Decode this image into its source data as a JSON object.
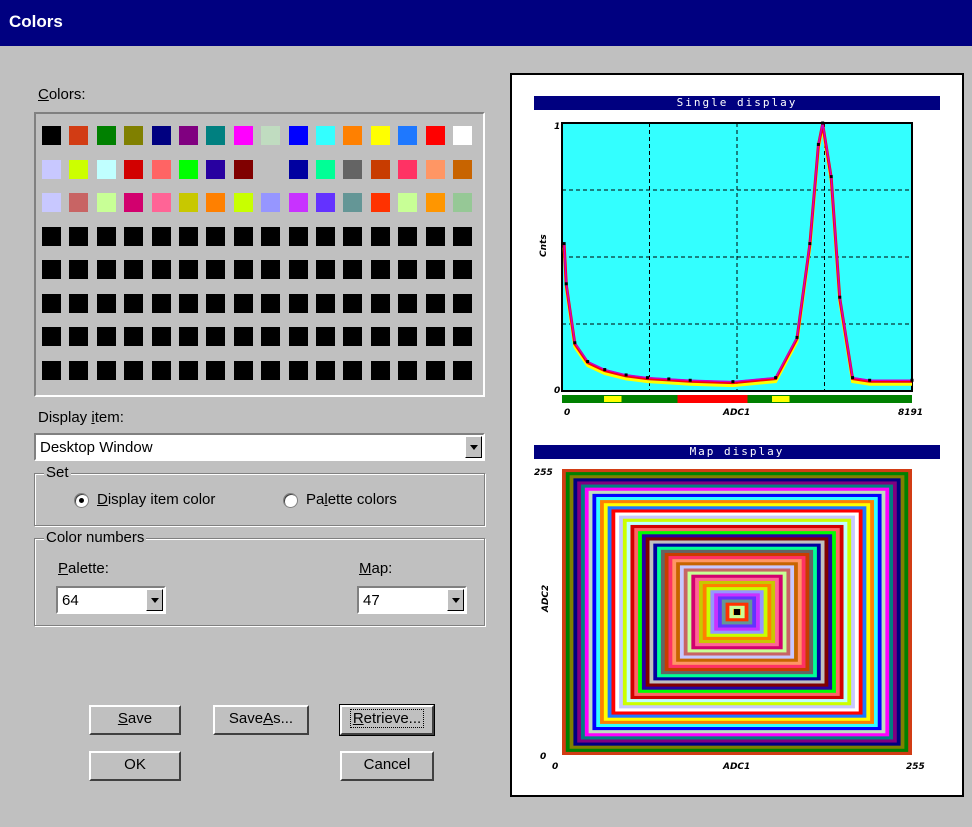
{
  "window": {
    "title": "Colors"
  },
  "colors_label": "Colors:",
  "palette": [
    [
      "#000000",
      "#d23c14",
      "#008000",
      "#808000",
      "#000080",
      "#800080",
      "#008080",
      "#ff00ff",
      "#c0dcc0",
      "#0000ff",
      "#33ffff",
      "#ff8000",
      "#ffff00",
      "#1e78ff",
      "#ff0000",
      "#ffffff"
    ],
    [
      "#c8c8ff",
      "#ccff00",
      "#c0ffff",
      "#d20000",
      "#ff6464",
      "#00ff00",
      "#2800a0",
      "#800000",
      "#c0c0c0",
      "#0000a0",
      "#00ff96",
      "#646464",
      "#c83c00",
      "#ff3264",
      "#ff9664",
      "#c86400"
    ],
    [
      "#c8c8ff",
      "#c86464",
      "#c8ff96",
      "#d2006e",
      "#ff6496",
      "#c8c800",
      "#ff8000",
      "#c8ff00",
      "#9696ff",
      "#c832ff",
      "#6432ff",
      "#649696",
      "#ff3200",
      "#c8ff96",
      "#ff9600",
      "#96c896"
    ],
    [
      "#000000",
      "#000000",
      "#000000",
      "#000000",
      "#000000",
      "#000000",
      "#000000",
      "#000000",
      "#000000",
      "#000000",
      "#000000",
      "#000000",
      "#000000",
      "#000000",
      "#000000",
      "#000000"
    ],
    [
      "#000000",
      "#000000",
      "#000000",
      "#000000",
      "#000000",
      "#000000",
      "#000000",
      "#000000",
      "#000000",
      "#000000",
      "#000000",
      "#000000",
      "#000000",
      "#000000",
      "#000000",
      "#000000"
    ],
    [
      "#000000",
      "#000000",
      "#000000",
      "#000000",
      "#000000",
      "#000000",
      "#000000",
      "#000000",
      "#000000",
      "#000000",
      "#000000",
      "#000000",
      "#000000",
      "#000000",
      "#000000",
      "#000000"
    ],
    [
      "#000000",
      "#000000",
      "#000000",
      "#000000",
      "#000000",
      "#000000",
      "#000000",
      "#000000",
      "#000000",
      "#000000",
      "#000000",
      "#000000",
      "#000000",
      "#000000",
      "#000000",
      "#000000"
    ],
    [
      "#000000",
      "#000000",
      "#000000",
      "#000000",
      "#000000",
      "#000000",
      "#000000",
      "#000000",
      "#000000",
      "#000000",
      "#000000",
      "#000000",
      "#000000",
      "#000000",
      "#000000",
      "#000000"
    ]
  ],
  "display_item": {
    "label": "Display item:",
    "value": "Desktop Window"
  },
  "set_group": {
    "title": "Set",
    "option_display": "Display item color",
    "option_palette": "Palette colors",
    "selected": "display"
  },
  "color_numbers": {
    "title": "Color numbers",
    "palette_label": "Palette:",
    "palette_value": "64",
    "map_label": "Map:",
    "map_value": "47"
  },
  "buttons": {
    "save": "Save",
    "save_as": "SaveAs...",
    "retrieve": "Retrieve...",
    "ok": "OK",
    "cancel": "Cancel"
  },
  "preview": {
    "single": {
      "title": "Single display",
      "ylabel": "Cnts",
      "xlabel": "ADC1",
      "y_top": "1",
      "y_bottom": "0",
      "x_left": "0",
      "x_right": "8191",
      "bg": "#33ffff"
    },
    "map": {
      "title": "Map display",
      "ylabel": "ADC2",
      "xlabel": "ADC1",
      "y_top": "255",
      "y_bottom": "0",
      "x_left": "0",
      "x_right": "255"
    }
  },
  "chart_data": {
    "type": "line",
    "title": "Single display",
    "xlabel": "ADC1",
    "ylabel": "Cnts",
    "xlim": [
      0,
      8191
    ],
    "ylim": [
      0,
      1
    ],
    "grid": true,
    "x": [
      50,
      100,
      300,
      600,
      1000,
      1500,
      2000,
      2500,
      3000,
      4000,
      5000,
      5500,
      5800,
      6000,
      6100,
      6300,
      6500,
      6800,
      7200,
      8191
    ],
    "y": [
      0.55,
      0.4,
      0.18,
      0.11,
      0.08,
      0.06,
      0.05,
      0.045,
      0.04,
      0.035,
      0.05,
      0.2,
      0.55,
      0.92,
      1.0,
      0.8,
      0.35,
      0.05,
      0.04,
      0.04
    ]
  }
}
